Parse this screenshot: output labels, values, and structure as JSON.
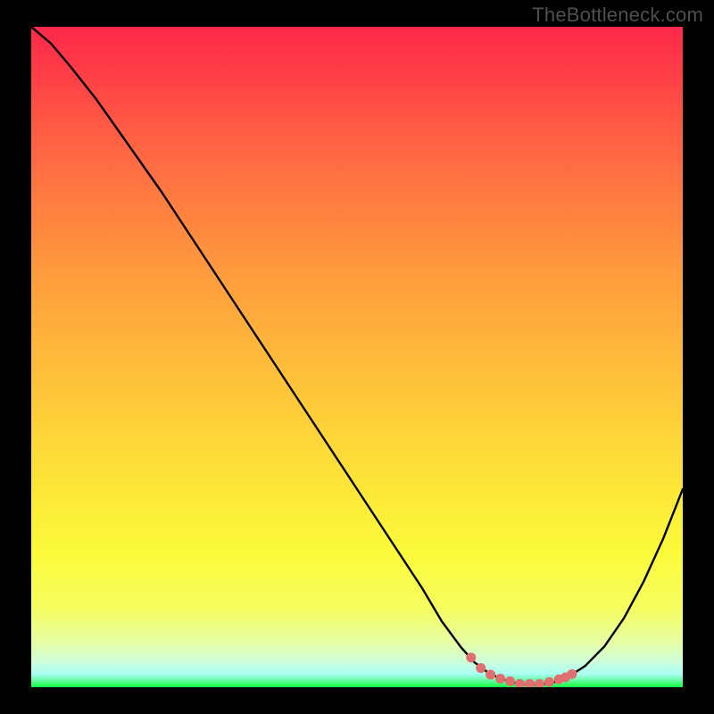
{
  "attribution": "TheBottleneck.com",
  "colors": {
    "frame": "#000000",
    "gradient_top": "#fe2a4b",
    "gradient_bottom": "#0ffc3d",
    "curve_stroke": "#000000",
    "dot_fill": "#e07070"
  },
  "chart_data": {
    "type": "line",
    "title": "",
    "xlabel": "",
    "ylabel": "",
    "xlim": [
      0,
      100
    ],
    "ylim": [
      0,
      100
    ],
    "grid": false,
    "legend": false,
    "series": [
      {
        "name": "bottleneck-curve",
        "x": [
          0,
          3,
          6,
          10,
          15,
          20,
          25,
          30,
          35,
          40,
          45,
          50,
          55,
          60,
          63,
          66,
          68,
          70,
          72,
          74,
          76,
          78,
          80,
          82,
          85,
          88,
          91,
          94,
          97,
          100
        ],
        "y": [
          100,
          97.5,
          94,
          89,
          82,
          75,
          67.5,
          60,
          52.5,
          45,
          37.5,
          30,
          22.5,
          15,
          10,
          6,
          3.8,
          2.3,
          1.3,
          0.7,
          0.4,
          0.4,
          0.7,
          1.3,
          3.2,
          6.2,
          10.5,
          16,
          22.5,
          30
        ]
      }
    ],
    "highlight_dots": {
      "name": "optimal-range",
      "x": [
        67.5,
        69,
        70.5,
        72,
        73.5,
        75,
        76.5,
        78,
        79.5,
        81,
        82,
        83
      ],
      "y": [
        4.5,
        2.9,
        1.9,
        1.3,
        0.9,
        0.5,
        0.5,
        0.5,
        0.8,
        1.2,
        1.5,
        2.0
      ]
    }
  }
}
